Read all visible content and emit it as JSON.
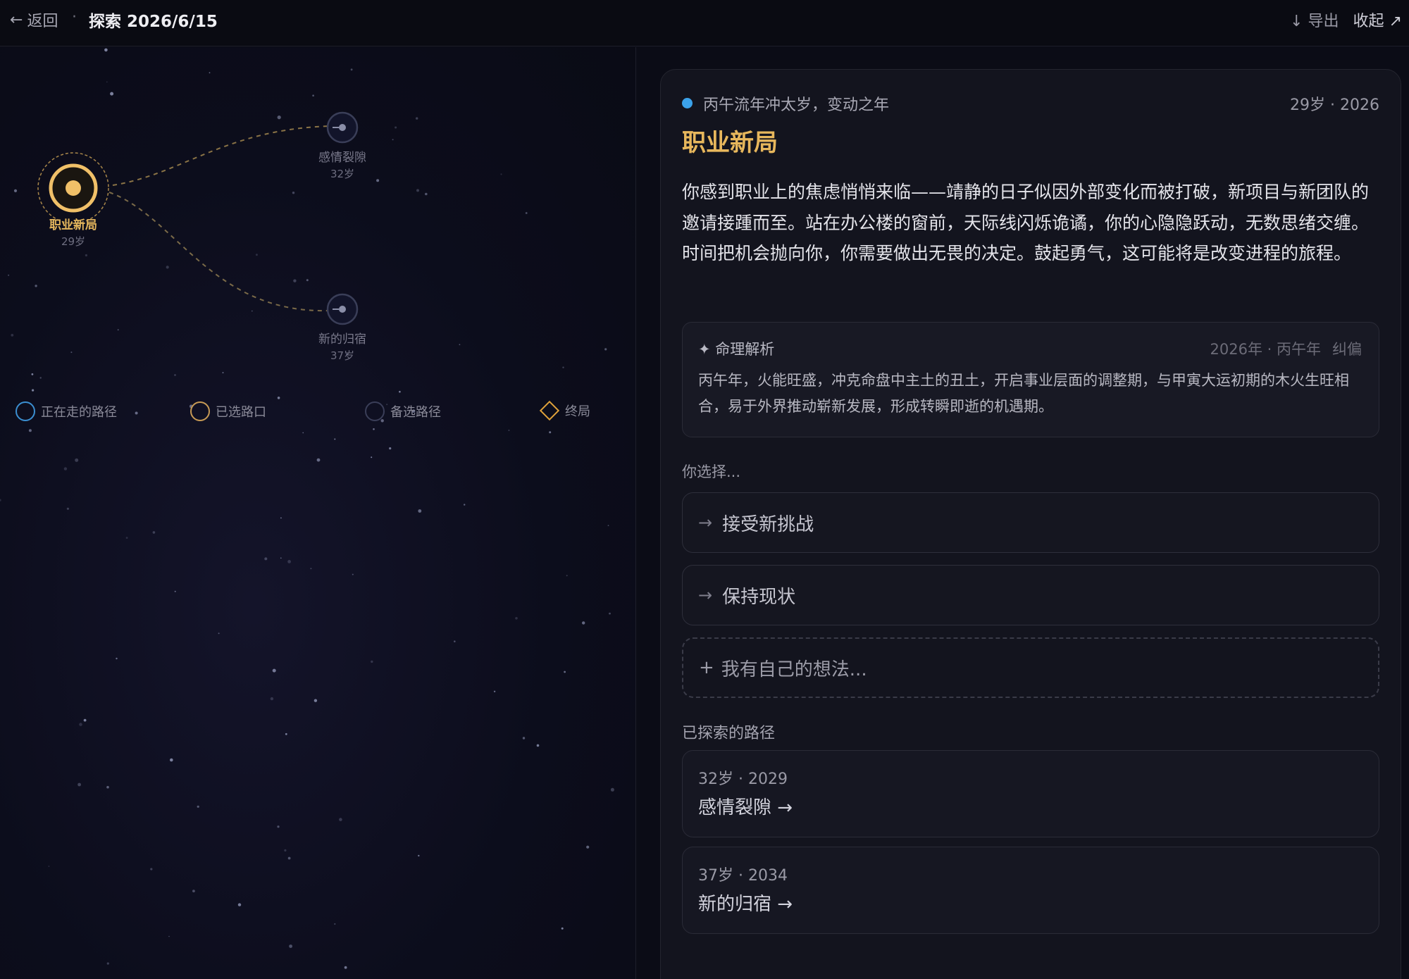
{
  "topbar": {
    "back_label": "返回",
    "separator": "·",
    "title": "探索 2026/6/15",
    "export_label": "导出",
    "collapse_label": "收起"
  },
  "map": {
    "nodes": [
      {
        "name": "职业新局",
        "age": "29岁",
        "state": "current"
      },
      {
        "name": "感情裂隙",
        "age": "32岁",
        "state": "alternative"
      },
      {
        "name": "新的归宿",
        "age": "37岁",
        "state": "alternative"
      }
    ],
    "legend": [
      {
        "label": "正在走的路径",
        "color": "#3b8fd1",
        "shape": "circle"
      },
      {
        "label": "已选路口",
        "color": "#c79a55",
        "shape": "circle"
      },
      {
        "label": "备选路径",
        "color": "#3a3e58",
        "shape": "circle"
      },
      {
        "label": "终局",
        "color": "#e0a23a",
        "shape": "diamond"
      }
    ]
  },
  "panel": {
    "year_tag": "丙午流年冲太岁，变动之年",
    "age_year": "29岁 · 2026",
    "heading": "职业新局",
    "story": "你感到职业上的焦虑悄悄来临——靖静的日子似因外部变化而被打破，新项目与新团队的邀请接踵而至。站在办公楼的窗前，天际线闪烁诡谲，你的心隐隐跃动，无数思绪交缠。时间把机会抛向你，你需要做出无畏的决定。鼓起勇气，这可能将是改变进程的旅程。",
    "analysis": {
      "title": "命理解析",
      "meta": "2026年 · 丙午年",
      "fix_label": "纠偏",
      "body": "丙午年，火能旺盛，冲克命盘中主土的丑土，开启事业层面的调整期，与甲寅大运初期的木火生旺相合，易于外界推动崭新发展，形成转瞬即逝的机遇期。"
    },
    "choose_label": "你选择...",
    "options": [
      "接受新挑战",
      "保持现状"
    ],
    "custom_option": "我有自己的想法...",
    "explored_label": "已探索的路径",
    "explored": [
      {
        "meta": "32岁 · 2029",
        "name": "感情裂隙 →"
      },
      {
        "meta": "37岁 · 2034",
        "name": "新的归宿 →"
      }
    ]
  },
  "colors": {
    "accent_gold": "#e7b75c",
    "accent_blue": "#3ba2ea",
    "background": "#0b0c16"
  }
}
